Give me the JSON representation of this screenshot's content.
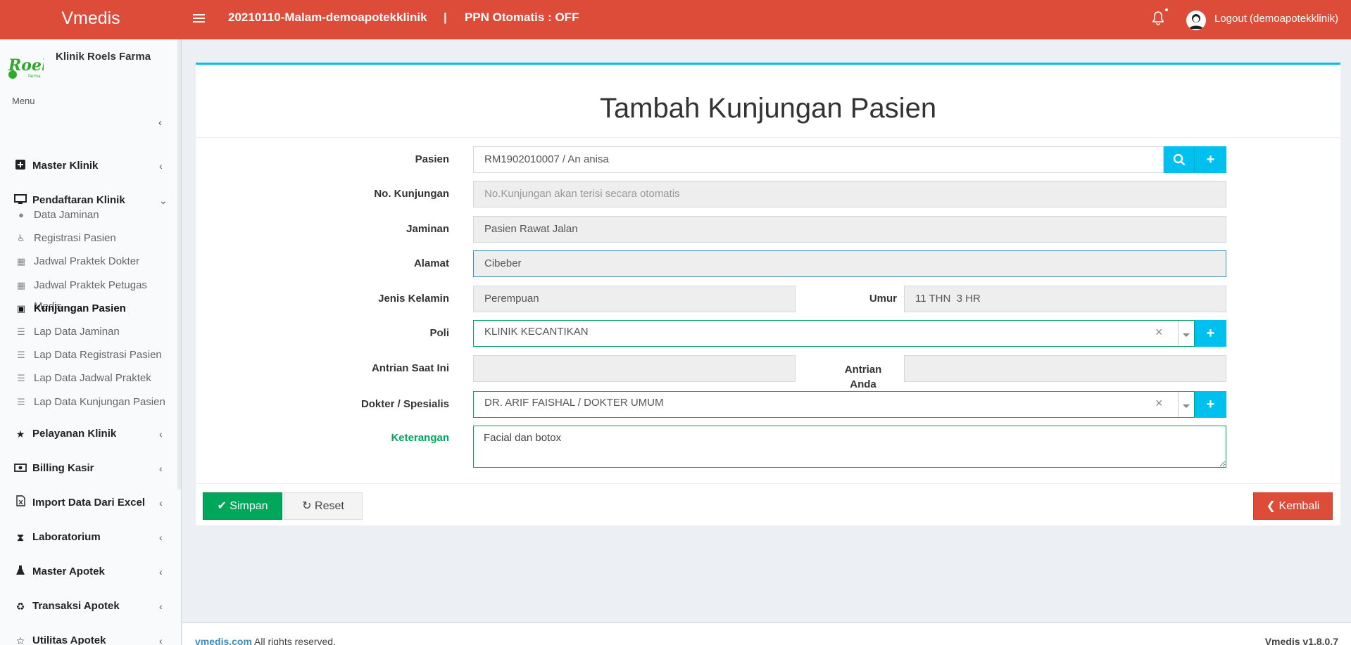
{
  "app": {
    "brand": "Vmedis",
    "session": "20210110-Malam-demoapotekklinik",
    "separator": "|",
    "ppn_status": "PPN Otomatis : OFF",
    "logout_label": "Logout (demoapotekklinik)"
  },
  "sidebar": {
    "clinic_name": "Klinik Roels Farma",
    "menu_label": "Menu",
    "collapse_icon": "chevron-left-icon",
    "items": [
      {
        "label": "Master Klinik",
        "icon": "plus-square-icon",
        "expanded": false
      },
      {
        "label": "Pendaftaran Klinik",
        "icon": "desktop-icon",
        "expanded": true
      },
      {
        "label": "Pelayanan Klinik",
        "icon": "star-icon",
        "expanded": false
      },
      {
        "label": "Billing Kasir",
        "icon": "money-icon",
        "expanded": false
      },
      {
        "label": "Import Data Dari Excel",
        "icon": "excel-file-icon",
        "expanded": false
      },
      {
        "label": "Laboratorium",
        "icon": "hourglass-icon",
        "expanded": false
      },
      {
        "label": "Master Apotek",
        "icon": "flask-icon",
        "expanded": false
      },
      {
        "label": "Transaksi Apotek",
        "icon": "recycle-icon",
        "expanded": false
      },
      {
        "label": "Utilitas Apotek",
        "icon": "star-outline-icon",
        "expanded": false
      }
    ],
    "subitems": [
      {
        "label": "Data Jaminan",
        "icon": "info-circle-icon",
        "active": false
      },
      {
        "label": "Registrasi Pasien",
        "icon": "wheelchair-icon",
        "active": false
      },
      {
        "label": "Jadwal Praktek Dokter",
        "icon": "calendar-icon",
        "active": false
      },
      {
        "label": "Jadwal Praktek Petugas Medis",
        "icon": "calendar-icon",
        "active": false
      },
      {
        "label": "Kunjungan Pasien",
        "icon": "id-card-icon",
        "active": true
      },
      {
        "label": "Lap Data Jaminan",
        "icon": "list-icon",
        "active": false
      },
      {
        "label": "Lap Data Registrasi Pasien",
        "icon": "list-icon",
        "active": false
      },
      {
        "label": "Lap Data Jadwal Praktek",
        "icon": "list-icon",
        "active": false
      },
      {
        "label": "Lap Data Kunjungan Pasien",
        "icon": "list-icon",
        "active": false
      }
    ]
  },
  "form": {
    "title": "Tambah Kunjungan Pasien",
    "pasien": {
      "label": "Pasien",
      "value": "RM1902010007 / An anisa"
    },
    "no_kunjungan": {
      "label": "No. Kunjungan",
      "placeholder": "No.Kunjungan akan terisi secara otomatis"
    },
    "jaminan": {
      "label": "Jaminan",
      "value": "Pasien Rawat Jalan"
    },
    "alamat": {
      "label": "Alamat",
      "value": "Cibeber"
    },
    "jenis_kelamin": {
      "label": "Jenis Kelamin",
      "value": "Perempuan"
    },
    "umur": {
      "label": "Umur",
      "value": "11 THN  3 HR"
    },
    "poli": {
      "label": "Poli",
      "value": "KLINIK KECANTIKAN"
    },
    "antrian_saat_ini": {
      "label": "Antrian Saat Ini",
      "value": ""
    },
    "antrian_anda": {
      "label_line1": "Antrian",
      "label_line2": "Anda",
      "value": ""
    },
    "dokter": {
      "label": "Dokter / Spesialis",
      "value": "DR. ARIF FAISHAL / DOKTER UMUM"
    },
    "keterangan": {
      "label": "Keterangan",
      "value": "Facial dan botox"
    },
    "clear_symbol": "×"
  },
  "buttons": {
    "save": "Simpan",
    "reset": "Reset",
    "back": "Kembali"
  },
  "footer": {
    "link": "vmedis.com",
    "rights": " All rights reserved.",
    "version": "Vmedis v1.8.0.7"
  },
  "colors": {
    "topbar": "#dd4b39",
    "accent_blue": "#00c0ef",
    "save_green": "#00a65a",
    "back_red": "#dd4b39"
  }
}
